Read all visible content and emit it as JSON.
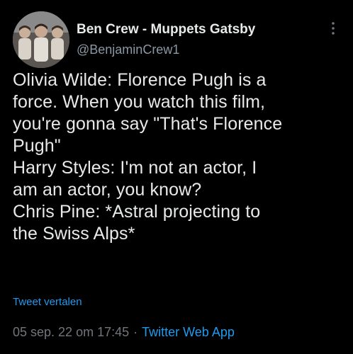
{
  "tweet": {
    "display_name": "Ben Crew - Muppets Gatsby",
    "handle": "@BenjaminCrew1",
    "text": "Olivia Wilde: Florence Pugh is a\nforce. When you watch this film,\nyou're gonna say \"That's Florence\nPugh\"\nHarry Styles: I'm not an actor, I\nam an actor, you know?\nChris Pine: *Astral projecting to\nthe Swiss Alps*",
    "translate_label": "Tweet vertalen",
    "date": "05 sep. 22 om 17:45",
    "separator": "·",
    "source": "Twitter Web App"
  },
  "icons": {
    "more": "more-vertical-icon",
    "avatar": "avatar"
  },
  "colors": {
    "background": "#000000",
    "text": "#e7e9ea",
    "muted": "#71767b",
    "link": "#1d9bf0"
  }
}
